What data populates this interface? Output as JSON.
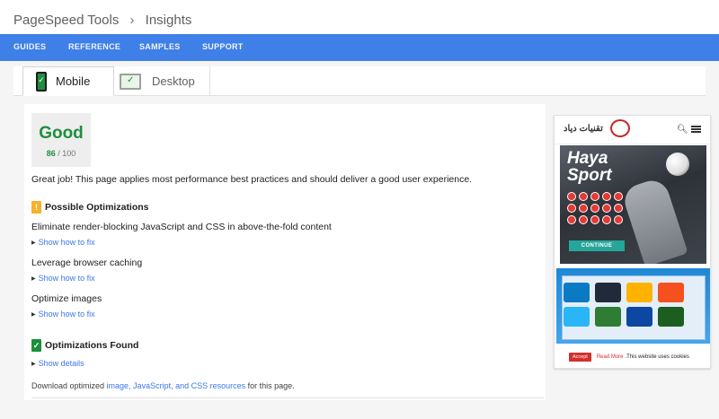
{
  "breadcrumb": {
    "root": "PageSpeed Tools",
    "separator": "›",
    "current": "Insights"
  },
  "nav": {
    "items": [
      "GUIDES",
      "REFERENCE",
      "SAMPLES",
      "SUPPORT"
    ]
  },
  "tabs": [
    {
      "label": "Mobile",
      "active": true
    },
    {
      "label": "Desktop",
      "active": false
    }
  ],
  "score": {
    "label": "Good",
    "value": "86",
    "max": "100",
    "color": "#1e8e3e"
  },
  "summary": "Great job! This page applies most performance best practices and should deliver a good user experience.",
  "possible": {
    "heading": "Possible Optimizations",
    "badge": "!",
    "rules": [
      {
        "title": "Eliminate render-blocking JavaScript and CSS in above-the-fold content",
        "link": "Show how to fix"
      },
      {
        "title": "Leverage browser caching",
        "link": "Show how to fix"
      },
      {
        "title": "Optimize images",
        "link": "Show how to fix"
      }
    ]
  },
  "found": {
    "heading": "Optimizations Found",
    "badge": "✓",
    "link": "Show details"
  },
  "download": {
    "prefix": "Download optimized ",
    "link": "image, JavaScript, and CSS resources",
    "suffix": " for this page."
  },
  "preview": {
    "site_logo": "تقنيات دياد",
    "ad_title_line1": "Haya",
    "ad_title_line2": "Sport",
    "ad_button": "CONTINUE",
    "cookie": {
      "accept": "Accept",
      "read_more": "Read More",
      "text": ".This website uses cookies"
    }
  },
  "colors": {
    "nav_blue": "#3f7fe8",
    "good_green": "#1e8e3e",
    "warn_amber": "#f6b02b",
    "link_blue": "#3b78e7"
  }
}
